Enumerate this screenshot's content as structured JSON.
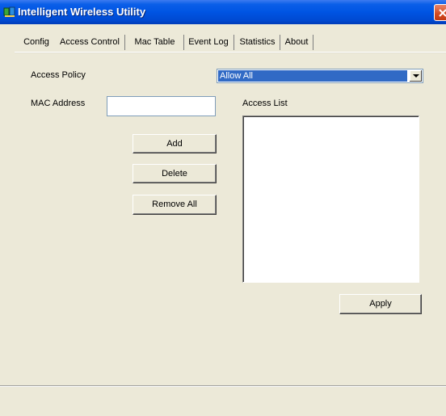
{
  "window": {
    "title": "Intelligent Wireless Utility"
  },
  "tabs": [
    {
      "label": "Config"
    },
    {
      "label": "Access Control"
    },
    {
      "label": "Mac Table"
    },
    {
      "label": "Event Log"
    },
    {
      "label": "Statistics"
    },
    {
      "label": "About"
    }
  ],
  "active_tab": "Access Control",
  "form": {
    "access_policy_label": "Access Policy",
    "access_policy_value": "Allow All",
    "mac_address_label": "MAC Address",
    "mac_address_value": "",
    "access_list_label": "Access List"
  },
  "buttons": {
    "add": "Add",
    "delete": "Delete",
    "remove_all": "Remove All",
    "apply": "Apply"
  },
  "colors": {
    "title_bar": "#0054e3",
    "selection": "#316ac5",
    "dialog_bg": "#ece9d8"
  },
  "icons": {
    "app": "wireless-utility-icon",
    "close": "close-icon",
    "dropdown": "chevron-down-icon"
  }
}
